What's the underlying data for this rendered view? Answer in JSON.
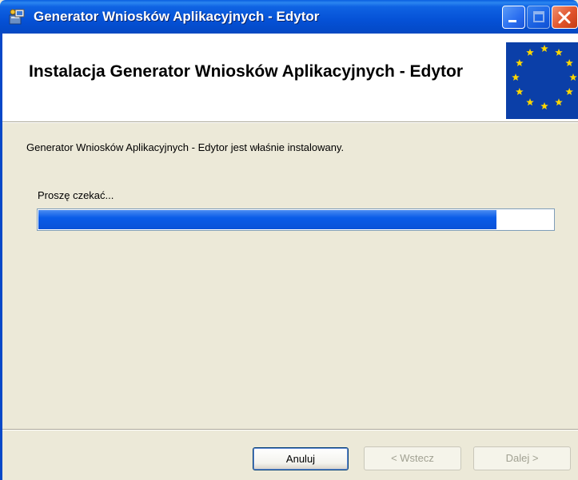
{
  "window": {
    "title": "Generator Wniosków Aplikacyjnych - Edytor"
  },
  "header": {
    "title": "Instalacja Generator Wniosków Aplikacyjnych - Edytor"
  },
  "status": {
    "message": "Generator Wniosków Aplikacyjnych - Edytor jest właśnie instalowany.",
    "wait_label": "Proszę czekać...",
    "progress_fraction": 0.89
  },
  "buttons": {
    "cancel": "Anuluj",
    "back": "< Wstecz",
    "next": "Dalej >"
  },
  "colors": {
    "title_bar": "#0551d6",
    "progress": "#0a5ce8",
    "dialog_bg": "#ece9d8"
  },
  "icons": {
    "app": "installer-icon",
    "header": "eu-flag-icon"
  }
}
